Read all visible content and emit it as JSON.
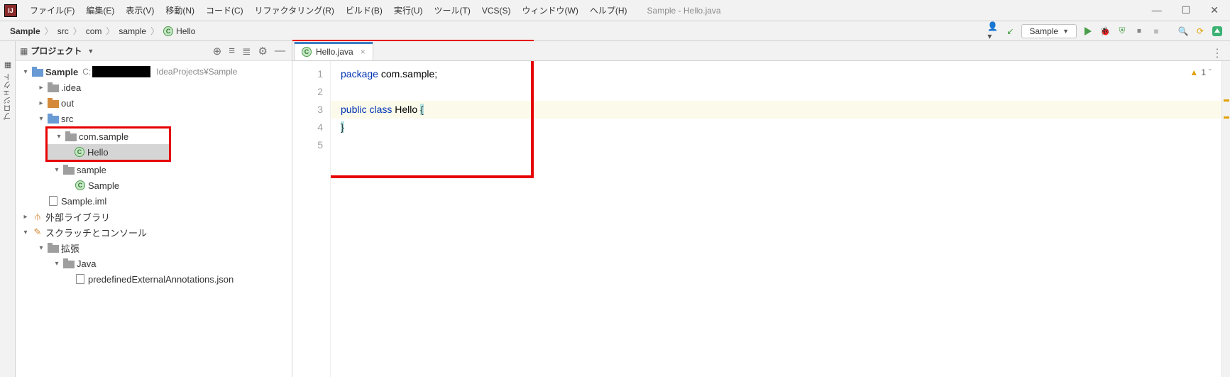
{
  "menu": {
    "items": [
      "ファイル(F)",
      "編集(E)",
      "表示(V)",
      "移動(N)",
      "コード(C)",
      "リファクタリング(R)",
      "ビルド(B)",
      "実行(U)",
      "ツール(T)",
      "VCS(S)",
      "ウィンドウ(W)",
      "ヘルプ(H)"
    ],
    "title": "Sample - Hello.java"
  },
  "breadcrumb": [
    "Sample",
    "src",
    "com",
    "sample",
    "Hello"
  ],
  "run_config": "Sample",
  "sidebar": {
    "title": "プロジェクト",
    "project": {
      "name": "Sample",
      "path_suffix": "IdeaProjects¥Sample"
    },
    "nodes": {
      "idea": ".idea",
      "out": "out",
      "src": "src",
      "pkg": "com.sample",
      "hello": "Hello",
      "sample_pkg": "sample",
      "sample_cls": "Sample",
      "iml": "Sample.iml",
      "ext_lib": "外部ライブラリ",
      "scratch": "スクラッチとコンソール",
      "ext": "拡張",
      "java": "Java",
      "annot": "predefinedExternalAnnotations.json"
    }
  },
  "tab": {
    "name": "Hello.java"
  },
  "code": {
    "lines": [
      "1",
      "2",
      "3",
      "4",
      "5"
    ],
    "l1_kw": "package",
    "l1_rest": " com.sample;",
    "l3_kw1": "public",
    "l3_kw2": "class",
    "l3_name": "Hello",
    "l3_brace": "{",
    "l4_brace": "}"
  },
  "warnings": {
    "count": "1"
  }
}
